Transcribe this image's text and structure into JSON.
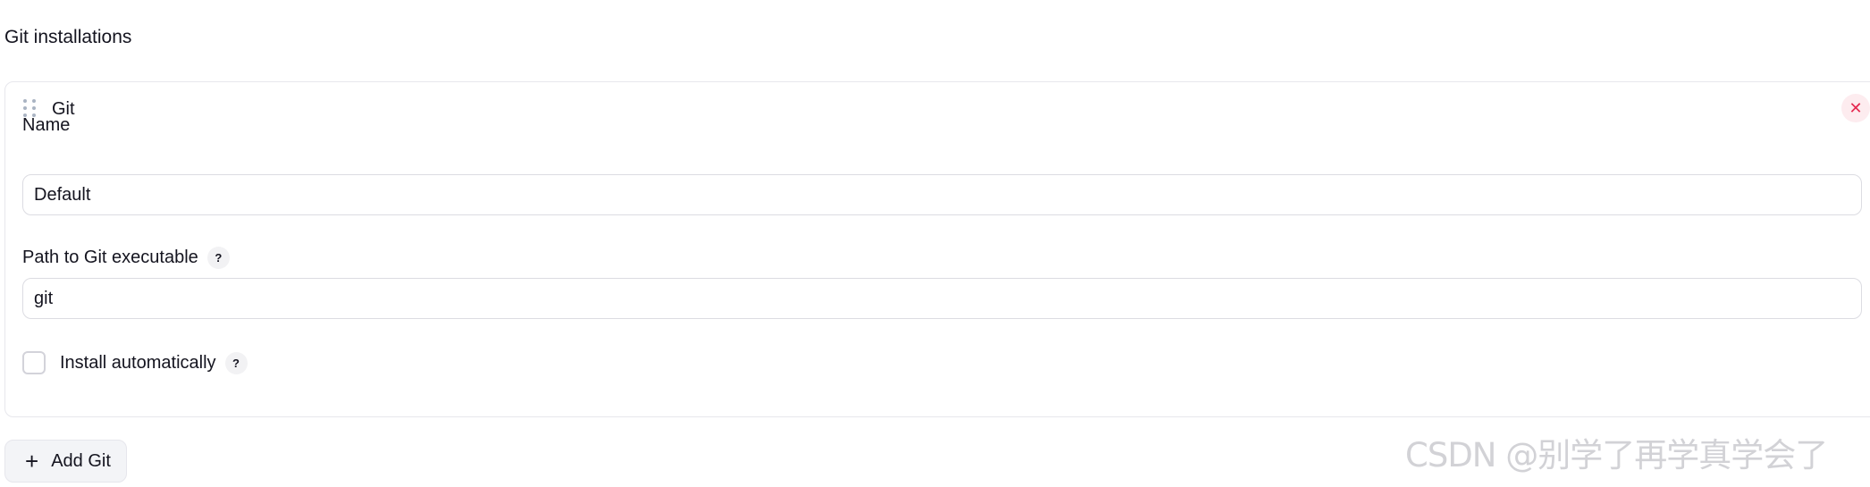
{
  "section": {
    "title": "Git installations"
  },
  "card": {
    "title": "Git",
    "close_icon": "close-icon",
    "drag_icon": "drag-handle-icon"
  },
  "fields": {
    "name": {
      "label": "Name",
      "value": "Default"
    },
    "path": {
      "label": "Path to Git executable",
      "value": "git",
      "help": "?"
    },
    "install": {
      "label": "Install automatically",
      "checked": false,
      "help": "?"
    }
  },
  "add_button": {
    "icon": "plus-icon",
    "label": "Add Git"
  },
  "watermark": "CSDN @别学了再学真学会了",
  "colors": {
    "close_bg": "#fdecef",
    "close_fg": "#e5284f",
    "border": "#dcdce2",
    "button_bg": "#f3f4f7"
  }
}
